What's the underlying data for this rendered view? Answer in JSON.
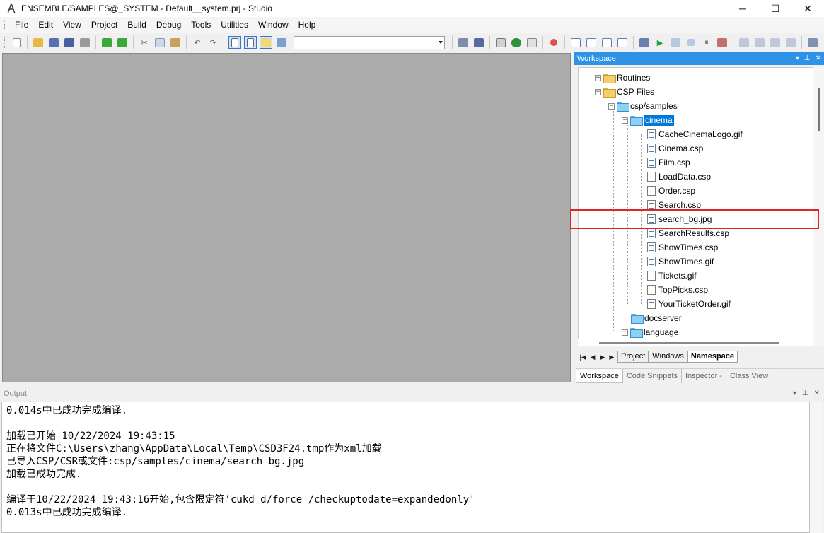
{
  "window": {
    "title": "ENSEMBLE/SAMPLES@_SYSTEM - Default__system.prj - Studio",
    "minimize": "─",
    "maximize": "☐",
    "close": "✕"
  },
  "menu": [
    "File",
    "Edit",
    "View",
    "Project",
    "Build",
    "Debug",
    "Tools",
    "Utilities",
    "Window",
    "Help"
  ],
  "workspace": {
    "title": "Workspace",
    "controls": [
      "▾",
      "⊥",
      "✕"
    ],
    "tree": [
      {
        "label": "Routines",
        "expander": "+",
        "icon": "folder-icon"
      },
      {
        "label": "CSP Files",
        "expander": "−",
        "icon": "folder-open-icon"
      },
      {
        "label": "csp/samples",
        "expander": "−",
        "icon": "folder-open-icon"
      },
      {
        "label": "cinema",
        "expander": "−",
        "icon": "folder-open-icon",
        "selected": true
      },
      {
        "label": "CacheCinemaLogo.gif",
        "icon": "file-icon"
      },
      {
        "label": "Cinema.csp",
        "icon": "file-icon"
      },
      {
        "label": "Film.csp",
        "icon": "file-icon"
      },
      {
        "label": "LoadData.csp",
        "icon": "file-icon"
      },
      {
        "label": "Order.csp",
        "icon": "file-icon"
      },
      {
        "label": "Search.csp",
        "icon": "file-icon"
      },
      {
        "label": "search_bg.jpg",
        "icon": "file-icon"
      },
      {
        "label": "SearchResults.csp",
        "icon": "file-icon"
      },
      {
        "label": "ShowTimes.csp",
        "icon": "file-icon"
      },
      {
        "label": "ShowTimes.gif",
        "icon": "file-icon"
      },
      {
        "label": "Tickets.gif",
        "icon": "file-icon"
      },
      {
        "label": "TopPicks.csp",
        "icon": "file-icon"
      },
      {
        "label": "YourTicketOrder.gif",
        "icon": "file-icon"
      },
      {
        "label": "docserver",
        "icon": "folder-icon"
      },
      {
        "label": "language",
        "expander": "+",
        "icon": "folder-icon"
      }
    ],
    "nav_buttons": [
      "|◀",
      "◀",
      "▶",
      "▶|"
    ],
    "bottom_tabs": [
      {
        "label": "Project",
        "active": false
      },
      {
        "label": "Windows",
        "active": false
      },
      {
        "label": "Namespace",
        "active": true
      }
    ],
    "panel_tabs": [
      {
        "label": "Workspace",
        "active": true
      },
      {
        "label": "Code Snippets",
        "active": false
      },
      {
        "label": "Inspector -",
        "active": false
      },
      {
        "label": "Class View",
        "active": false
      }
    ]
  },
  "output": {
    "title": "Output",
    "controls": [
      "▾",
      "⊥",
      "✕"
    ],
    "lines": [
      "0.014s中已成功完成编译.",
      "",
      "加载已开始 10/22/2024 19:43:15",
      "正在将文件C:\\Users\\zhang\\AppData\\Local\\Temp\\CSD3F24.tmp作为xml加载",
      "已导入CSP/CSR或文件:csp/samples/cinema/search_bg.jpg",
      "加载已成功完成.",
      "",
      "编译于10/22/2024 19:43:16开始,包含限定符'cukd d/force /checkuptodate=expandedonly'",
      "0.013s中已成功完成编译."
    ]
  },
  "colors": {
    "accent": "#2e93e6",
    "selection": "#0078d7",
    "highlight_box": "#e02424",
    "editor_bg": "#ababab"
  }
}
